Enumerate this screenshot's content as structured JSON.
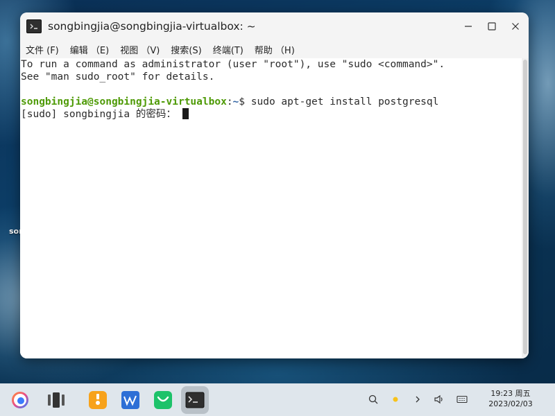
{
  "desktop": {
    "icon_label": "songbingjia"
  },
  "window": {
    "title": "songbingjia@songbingjia-virtualbox: ~",
    "controls": {
      "minimize": "−",
      "maximize": "☐",
      "close": "✕"
    }
  },
  "menu": [
    {
      "label": "文件 (F)"
    },
    {
      "label": "编辑 （E)"
    },
    {
      "label": "视图 （V)"
    },
    {
      "label": "搜索(S)"
    },
    {
      "label": "终端(T)"
    },
    {
      "label": "帮助 （H)"
    }
  ],
  "terminal": {
    "lines": [
      "To run a command as administrator (user \"root\"), use \"sudo <command>\".",
      "See \"man sudo_root\" for details.",
      ""
    ],
    "prompt_user": "songbingjia@songbingjia-virtualbox",
    "prompt_sep": ":",
    "prompt_path": "~",
    "prompt_symbol": "$ ",
    "command": "sudo apt-get install postgresql",
    "password_prompt": "[sudo] songbingjia 的密码： "
  },
  "taskbar": {
    "apps": [
      {
        "name": "start-menu"
      },
      {
        "name": "multitask-view"
      },
      {
        "name": "file-manager"
      },
      {
        "name": "wps-office"
      },
      {
        "name": "wechat"
      },
      {
        "name": "terminal",
        "active": true
      }
    ],
    "tray_icons": [
      "search-icon",
      "notification-dot-icon",
      "chevron-right-icon",
      "volume-icon",
      "keyboard-icon"
    ],
    "clock_time": "19:23 周五",
    "clock_date": "2023/02/03"
  },
  "colors": {
    "prompt_user": "#4e9a06",
    "prompt_path": "#3465a4",
    "accent_orange": "#f7a21b",
    "wps_blue": "#2d6fd6",
    "wechat_green": "#1dc26a"
  }
}
